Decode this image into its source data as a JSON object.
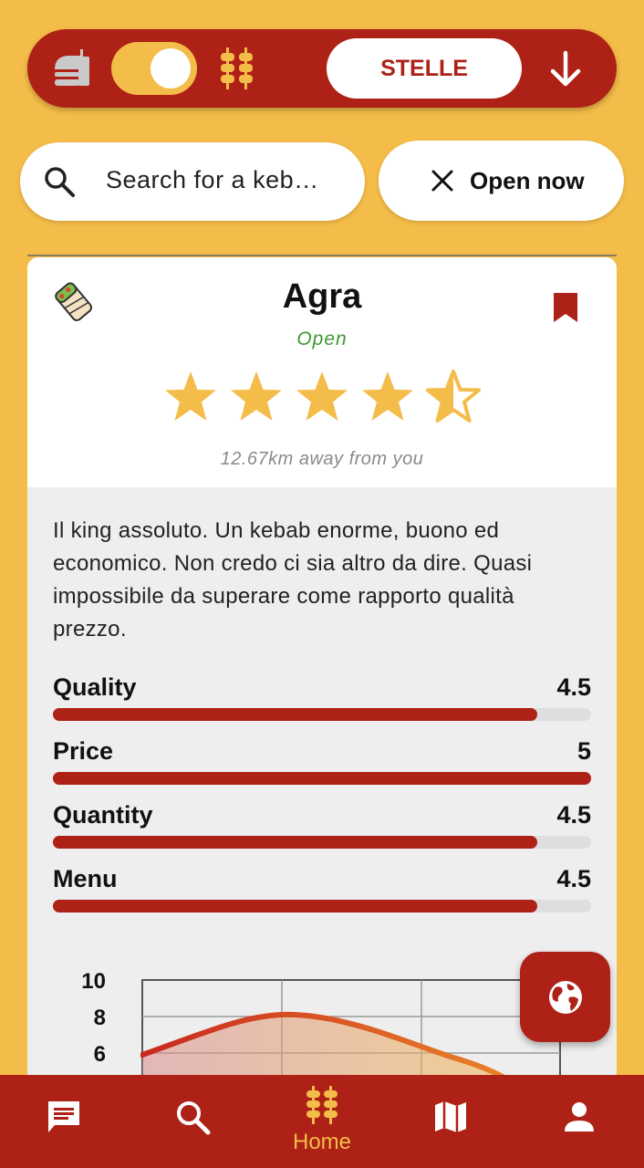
{
  "topbar": {
    "sort_label": "STELLE",
    "toggle_state": "on"
  },
  "search": {
    "placeholder": "Search for a keb…",
    "open_now_label": "Open now"
  },
  "restaurant": {
    "name": "Agra",
    "status": "Open",
    "rating": 4.5,
    "distance": "12.67km away from you",
    "bookmarked": true,
    "description": "Il king assoluto. Un kebab enorme, buono ed economico. Non credo ci sia altro da dire. Quasi impossibile da superare come rapporto qualità prezzo.",
    "metrics": [
      {
        "name": "Quality",
        "value": "4.5",
        "fraction": 0.9
      },
      {
        "name": "Price",
        "value": "5",
        "fraction": 1.0
      },
      {
        "name": "Quantity",
        "value": "4.5",
        "fraction": 0.9
      },
      {
        "name": "Menu",
        "value": "4.5",
        "fraction": 0.9
      }
    ]
  },
  "chart": {
    "y_ticks": [
      "10",
      "8",
      "6"
    ]
  },
  "bottom_nav": {
    "items": [
      {
        "icon": "chat-icon",
        "label": ""
      },
      {
        "icon": "search-icon",
        "label": ""
      },
      {
        "icon": "skewer-icon",
        "label": "Home"
      },
      {
        "icon": "map-icon",
        "label": ""
      },
      {
        "icon": "person-icon",
        "label": ""
      }
    ]
  },
  "colors": {
    "primary": "#AE2116",
    "accent": "#F4BC48",
    "open": "#3E9A32",
    "star": "#F4BC48"
  }
}
